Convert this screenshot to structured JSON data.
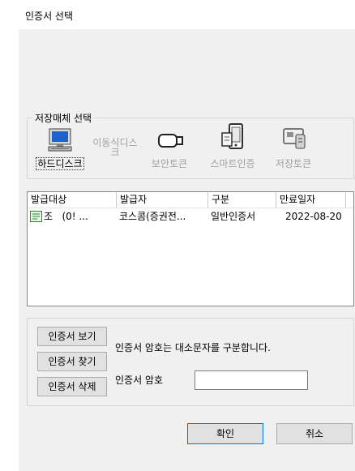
{
  "window": {
    "title": "인증서 선택"
  },
  "storage": {
    "legend": "저장매체 선택",
    "items": [
      {
        "label": "하드디스크",
        "state": "selected",
        "icon": "monitor-icon"
      },
      {
        "label": "이동식디스\n크",
        "state": "disabled",
        "icon": "removable-disk-icon"
      },
      {
        "label": "보안토큰",
        "state": "disabled",
        "icon": "usb-token-icon"
      },
      {
        "label": "스마트인증",
        "state": "disabled",
        "icon": "smartphone-icon"
      },
      {
        "label": "저장토큰",
        "state": "disabled",
        "icon": "storage-token-icon"
      }
    ]
  },
  "cert_table": {
    "columns": [
      "발급대상",
      "발급자",
      "구분",
      "만료일자"
    ],
    "rows": [
      {
        "subject": "조   (0! ...",
        "issuer": "코스콤(증권전...",
        "type": "일반인증서",
        "expiry": "2022-08-20",
        "icon": "certificate-icon"
      }
    ]
  },
  "actions": {
    "view": "인증서 보기",
    "find": "인증서 찾기",
    "delete": "인증서 삭제",
    "notice": "인증서 암호는 대소문자를 구분합니다.",
    "password_label": "인증서 암호",
    "password_value": ""
  },
  "footer": {
    "ok": "확인",
    "cancel": "취소"
  },
  "colors": {
    "accent": "#0078d7",
    "disabled_text": "#a0a0a0",
    "background": "#f0f0f0"
  }
}
